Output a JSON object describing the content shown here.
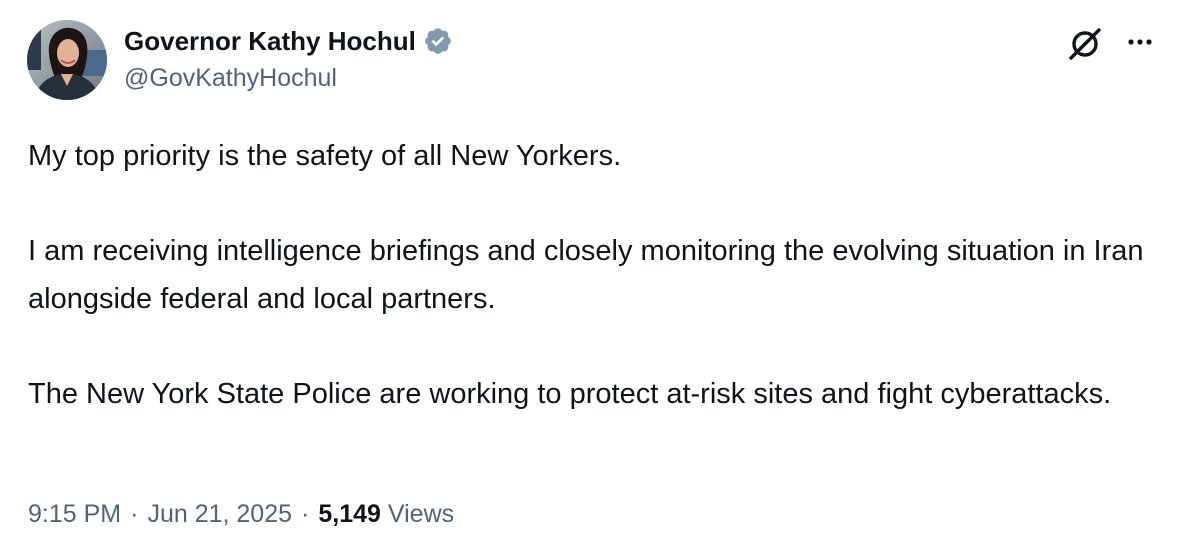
{
  "author": {
    "display_name": "Governor Kathy Hochul",
    "handle": "@GovKathyHochul",
    "verified_color": "#829aab",
    "avatar": "profile-photo"
  },
  "toolbar": {
    "grok_icon": "grok-slash-circle-icon",
    "more_icon": "more-dots-icon"
  },
  "tweet": {
    "paragraphs": [
      "My top priority is the safety of all New Yorkers.",
      "I am receiving intelligence briefings and closely monitoring the evolving situation in Iran alongside federal and local partners.",
      "The New York State Police are working to protect at-risk sites and fight cyberattacks."
    ]
  },
  "meta": {
    "time": "9:15 PM",
    "separator": "·",
    "date": "Jun 21, 2025",
    "views_count": "5,149",
    "views_label": "Views"
  },
  "colors": {
    "text_primary": "#0f1419",
    "text_secondary": "#536471",
    "background": "#ffffff"
  }
}
